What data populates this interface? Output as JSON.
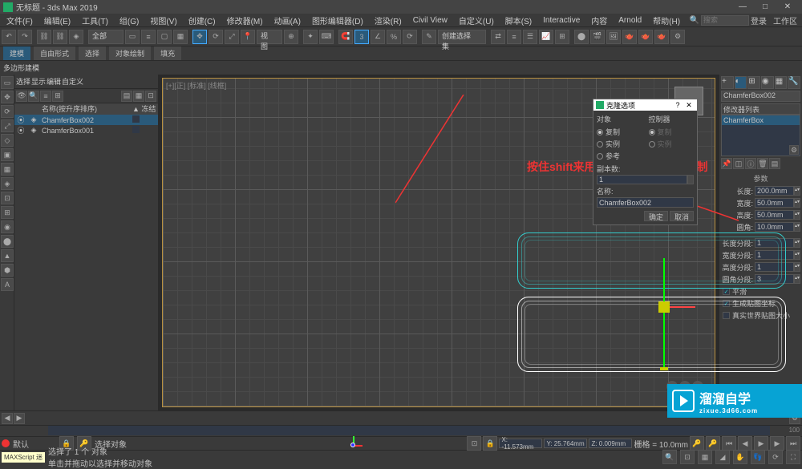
{
  "window": {
    "title": "无标题 - 3ds Max 2019"
  },
  "menu": {
    "items": [
      "文件(F)",
      "编辑(E)",
      "工具(T)",
      "组(G)",
      "视图(V)",
      "创建(C)",
      "修改器(M)",
      "动画(A)",
      "图形编辑器(D)",
      "渲染(R)",
      "Civil View",
      "自定义(U)",
      "脚本(S)",
      "Interactive",
      "内容",
      "Arnold",
      "帮助(H)"
    ],
    "search_placeholder": "搜索",
    "right": [
      "登录",
      "工作区"
    ]
  },
  "toolbar": {
    "dropdown1": "全部",
    "dropdown2": "创建选择集"
  },
  "tabs": {
    "items": [
      "建模",
      "自由形式",
      "选择",
      "对象绘制",
      "填充"
    ],
    "active": 0
  },
  "ribbon": {
    "item": "多边形建模"
  },
  "scene": {
    "col_name": "名称(按升序排序)",
    "col_frozen": "▲ 冻结",
    "rows": [
      {
        "name": "ChamferBox002",
        "sel": true
      },
      {
        "name": "ChamferBox001",
        "sel": false
      }
    ]
  },
  "viewport": {
    "label": "[+][正] [标准] [线框]",
    "hint": "按住shift来用鼠标左键移动可以复制"
  },
  "dialog": {
    "title": "克隆选项",
    "group_obj": "对象",
    "group_ctrl": "控制器",
    "opt_copy": "复制",
    "opt_instance": "实例",
    "opt_reference": "参考",
    "copies_label": "副本数:",
    "copies_value": "1",
    "name_label": "名称:",
    "name_value": "ChamferBox002",
    "ok": "确定",
    "cancel": "取消"
  },
  "right": {
    "name_field": "ChamferBox002",
    "rollout_modlist": "修改器列表",
    "type": "ChamferBox",
    "section_params": "参数",
    "params": [
      {
        "label": "长度:",
        "value": "200.0mm"
      },
      {
        "label": "宽度:",
        "value": "50.0mm"
      },
      {
        "label": "高度:",
        "value": "50.0mm"
      },
      {
        "label": "圆角:",
        "value": "10.0mm"
      }
    ],
    "segs": [
      {
        "label": "长度分段:",
        "value": "1"
      },
      {
        "label": "宽度分段:",
        "value": "1"
      },
      {
        "label": "高度分段:",
        "value": "1"
      },
      {
        "label": "圆角分段:",
        "value": "3"
      }
    ],
    "check_smooth": "平滑",
    "check_genmap": "生成贴图坐标",
    "check_realworld": "真实世界贴图大小"
  },
  "timeline": {
    "frame": "0 / 100",
    "selinfo": "选择对象"
  },
  "status": {
    "sel": "选择了 1 个 对象",
    "hint": "单击并拖动以选择并移动对象",
    "x": "X: -11.573mm",
    "y": "Y: 25.764mm",
    "z": "Z: 0.009mm",
    "grid": "栅格 = 10.0mm",
    "maxscript": "MAXScript 迷"
  },
  "watermark": {
    "main": "溜溜自学",
    "sub": "zixue.3d66.com"
  },
  "bottom_label": "默认"
}
